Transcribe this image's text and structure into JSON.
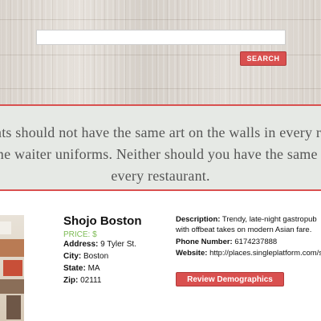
{
  "search": {
    "input_value": "",
    "button_label": "SEARCH"
  },
  "quote": {
    "line1": "Restaurants should not have the same art on the walls in every restaurant,",
    "line2": "or the same waiter uniforms. Neither should you have the same service in",
    "line3": "every restaurant."
  },
  "restaurant": {
    "name": "Shojo Boston",
    "price": "PRICE: $",
    "address_label": "Address:",
    "address": "9 Tyler St.",
    "city_label": "City:",
    "city": "Boston",
    "state_label": "State:",
    "state": "MA",
    "zip_label": "Zip:",
    "zip": "02111",
    "description_label": "Description:",
    "description": "Trendy, late-night gastropub with offbeat takes on modern Asian fare.",
    "phone_label": "Phone Number:",
    "phone": "6174237888",
    "website_label": "Website:",
    "website": "http://places.singleplatform.com/shojo",
    "review_button_label": "Review Demographics"
  },
  "colors": {
    "accent_red": "#d9504f",
    "price_green": "#7dbb54",
    "banner_bg": "#e6e9e5"
  }
}
